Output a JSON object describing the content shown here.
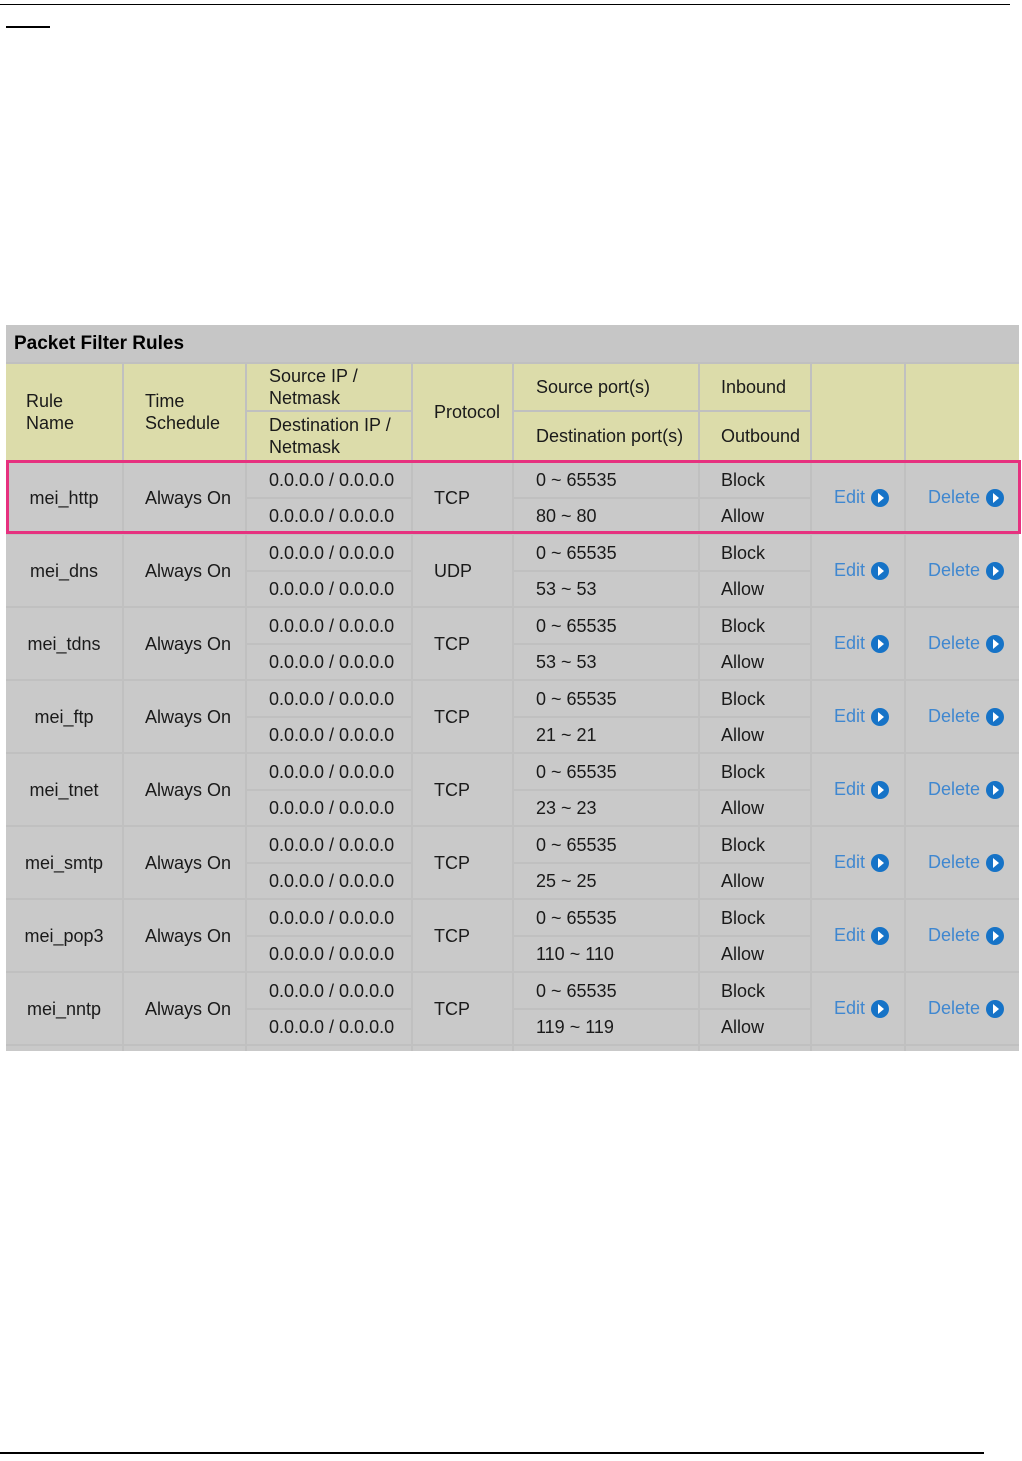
{
  "panel": {
    "title": "Packet Filter Rules"
  },
  "headers": {
    "rule_name": "Rule\nName",
    "time_schedule": "Time\nSchedule",
    "src_ip": "Source IP /\nNetmask",
    "dst_ip": "Destination IP /\nNetmask",
    "protocol": "Protocol",
    "src_port": "Source port(s)",
    "dst_port": "Destination port(s)",
    "inbound": "Inbound",
    "outbound": "Outbound"
  },
  "rules": [
    {
      "name": "mei_http",
      "schedule": "Always On",
      "src_ip": "0.0.0.0 / 0.0.0.0",
      "dst_ip": "0.0.0.0 / 0.0.0.0",
      "protocol": "TCP",
      "src_port": "0 ~ 65535",
      "dst_port": "80 ~ 80",
      "inbound": "Block",
      "outbound": "Allow",
      "edit": "Edit",
      "delete": "Delete"
    },
    {
      "name": "mei_dns",
      "schedule": "Always On",
      "src_ip": "0.0.0.0 / 0.0.0.0",
      "dst_ip": "0.0.0.0 / 0.0.0.0",
      "protocol": "UDP",
      "src_port": "0 ~ 65535",
      "dst_port": "53 ~ 53",
      "inbound": "Block",
      "outbound": "Allow",
      "edit": "Edit",
      "delete": "Delete"
    },
    {
      "name": "mei_tdns",
      "schedule": "Always On",
      "src_ip": "0.0.0.0 / 0.0.0.0",
      "dst_ip": "0.0.0.0 / 0.0.0.0",
      "protocol": "TCP",
      "src_port": "0 ~ 65535",
      "dst_port": "53 ~ 53",
      "inbound": "Block",
      "outbound": "Allow",
      "edit": "Edit",
      "delete": "Delete"
    },
    {
      "name": "mei_ftp",
      "schedule": "Always On",
      "src_ip": "0.0.0.0 / 0.0.0.0",
      "dst_ip": "0.0.0.0 / 0.0.0.0",
      "protocol": "TCP",
      "src_port": "0 ~ 65535",
      "dst_port": "21 ~ 21",
      "inbound": "Block",
      "outbound": "Allow",
      "edit": "Edit",
      "delete": "Delete"
    },
    {
      "name": "mei_tnet",
      "schedule": "Always On",
      "src_ip": "0.0.0.0 / 0.0.0.0",
      "dst_ip": "0.0.0.0 / 0.0.0.0",
      "protocol": "TCP",
      "src_port": "0 ~ 65535",
      "dst_port": "23 ~ 23",
      "inbound": "Block",
      "outbound": "Allow",
      "edit": "Edit",
      "delete": "Delete"
    },
    {
      "name": "mei_smtp",
      "schedule": "Always On",
      "src_ip": "0.0.0.0 / 0.0.0.0",
      "dst_ip": "0.0.0.0 / 0.0.0.0",
      "protocol": "TCP",
      "src_port": "0 ~ 65535",
      "dst_port": "25 ~ 25",
      "inbound": "Block",
      "outbound": "Allow",
      "edit": "Edit",
      "delete": "Delete"
    },
    {
      "name": "mei_pop3",
      "schedule": "Always On",
      "src_ip": "0.0.0.0 / 0.0.0.0",
      "dst_ip": "0.0.0.0 / 0.0.0.0",
      "protocol": "TCP",
      "src_port": "0 ~ 65535",
      "dst_port": "110 ~ 110",
      "inbound": "Block",
      "outbound": "Allow",
      "edit": "Edit",
      "delete": "Delete"
    },
    {
      "name": "mei_nntp",
      "schedule": "Always On",
      "src_ip": "0.0.0.0 / 0.0.0.0",
      "dst_ip": "0.0.0.0 / 0.0.0.0",
      "protocol": "TCP",
      "src_port": "0 ~ 65535",
      "dst_port": "119 ~ 119",
      "inbound": "Block",
      "outbound": "Allow",
      "edit": "Edit",
      "delete": "Delete"
    }
  ],
  "colors": {
    "header_bg": "#dcdcaa",
    "row_bg": "#c9c9c9",
    "highlight": "#e6317f",
    "link": "#3f87d0",
    "arrow": "#1673c7"
  },
  "icons": {
    "action": "arrow-circle-right-icon"
  }
}
